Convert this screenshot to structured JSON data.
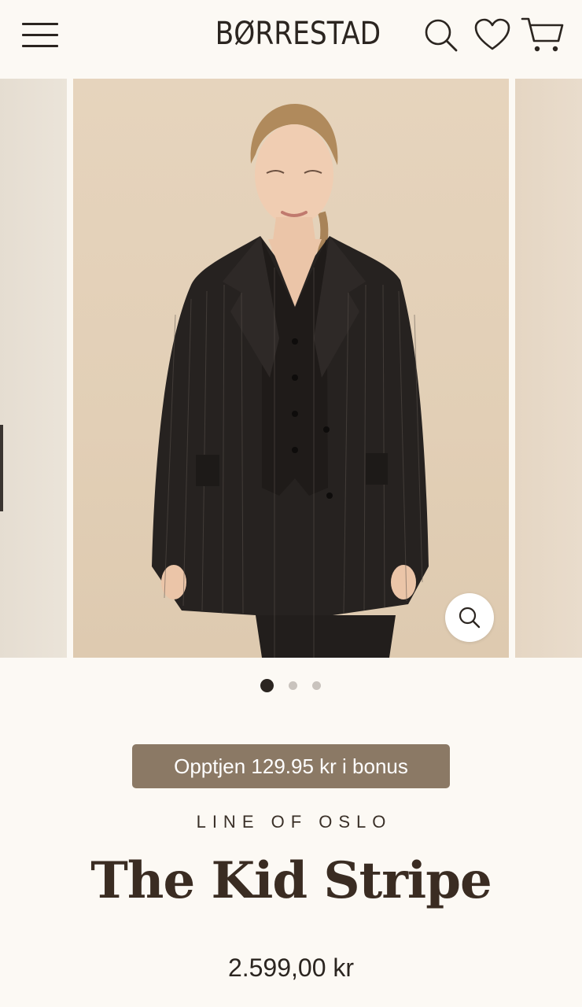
{
  "header": {
    "logo": "BØRRESTAD",
    "menu_icon": "hamburger-menu-icon",
    "search_icon": "search-icon",
    "wishlist_icon": "heart-icon",
    "cart_icon": "cart-icon"
  },
  "gallery": {
    "image_subject": "model wearing black pinstripe oversized blazer, waistcoat and trousers",
    "zoom_icon": "zoom-magnifier-icon",
    "slide_count": 3,
    "active_slide": 1
  },
  "product": {
    "bonus_label": "Opptjen 129.95 kr i bonus",
    "brand": "LINE OF OSLO",
    "title": "The Kid Stripe",
    "price": "2.599,00 kr"
  },
  "colors": {
    "background": "#fcf9f4",
    "bonus_bg": "#8b7965",
    "text_dark": "#2b2520",
    "photo_bg": "#e4d1b9"
  }
}
